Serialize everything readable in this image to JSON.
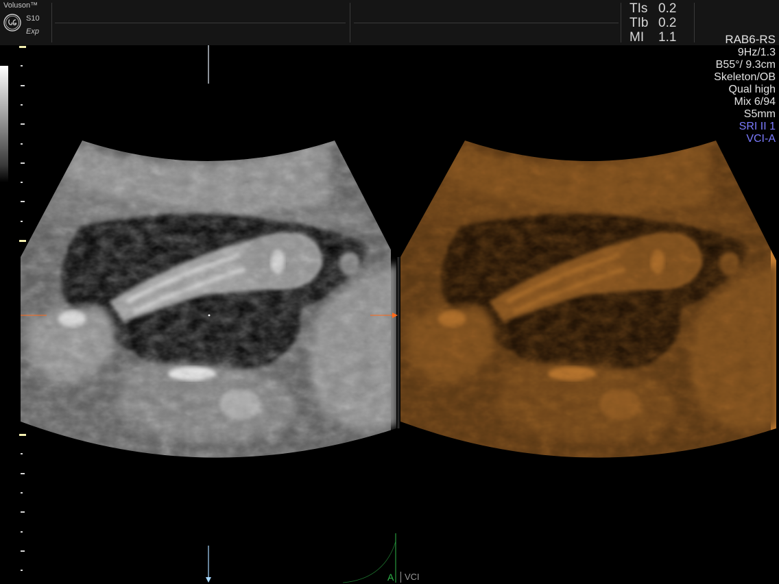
{
  "header": {
    "brand_name": "Voluson™",
    "model": "S10",
    "model_sub": "Exp",
    "logo_icon": "ge-logo-icon",
    "indices": [
      {
        "label": "TIs",
        "value": "0.2"
      },
      {
        "label": "TIb",
        "value": "0.2"
      },
      {
        "label": "MI",
        "value": "1.1"
      }
    ]
  },
  "params": {
    "probe": "RAB6-RS",
    "frame_rate": "9Hz/1.3",
    "angle_depth": "B55°/ 9.3cm",
    "preset": "Skeleton/OB",
    "quality": "Qual high",
    "mix": "Mix 6/94",
    "slice": "S5mm",
    "sri": "SRI II 1",
    "vci": "VCI-A",
    "highlight_color": "#7b7bff"
  },
  "footer": {
    "mode_a": "A",
    "mode_vci": "VCI",
    "mode_a_color": "#2fb84a"
  },
  "colors": {
    "header_bg": "#151515",
    "marker_orange": "#ff6a1a",
    "marker_blue": "#a8d8ff",
    "tint_sepia": "#c47a30"
  }
}
